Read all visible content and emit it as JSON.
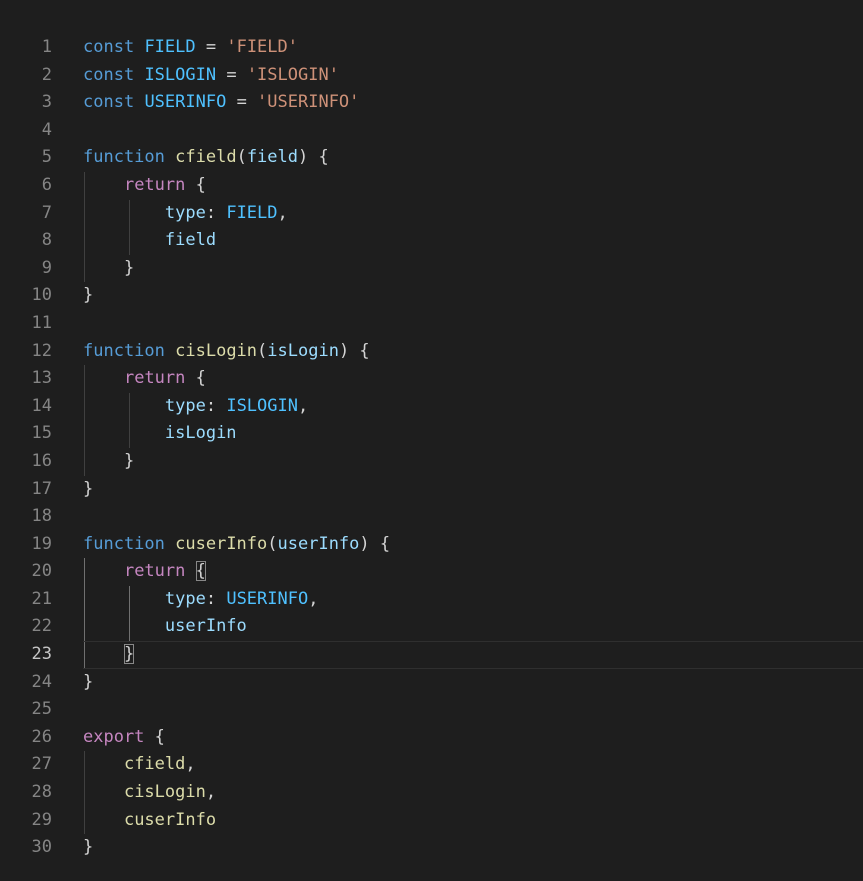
{
  "editor": {
    "active_line": 23,
    "lines": [
      {
        "n": "1",
        "tokens": [
          [
            "kw",
            "const"
          ],
          [
            "p",
            " "
          ],
          [
            "c",
            "FIELD"
          ],
          [
            "p",
            " = "
          ],
          [
            "s",
            "'FIELD'"
          ]
        ]
      },
      {
        "n": "2",
        "tokens": [
          [
            "kw",
            "const"
          ],
          [
            "p",
            " "
          ],
          [
            "c",
            "ISLOGIN"
          ],
          [
            "p",
            " = "
          ],
          [
            "s",
            "'ISLOGIN'"
          ]
        ]
      },
      {
        "n": "3",
        "tokens": [
          [
            "kw",
            "const"
          ],
          [
            "p",
            " "
          ],
          [
            "c",
            "USERINFO"
          ],
          [
            "p",
            " = "
          ],
          [
            "s",
            "'USERINFO'"
          ]
        ]
      },
      {
        "n": "4",
        "tokens": []
      },
      {
        "n": "5",
        "tokens": [
          [
            "kw",
            "function"
          ],
          [
            "p",
            " "
          ],
          [
            "f",
            "cfield"
          ],
          [
            "p",
            "("
          ],
          [
            "v",
            "field"
          ],
          [
            "p",
            ") {"
          ]
        ]
      },
      {
        "n": "6",
        "tokens": [
          [
            "p",
            "    "
          ],
          [
            "ctl",
            "return"
          ],
          [
            "p",
            " {"
          ]
        ]
      },
      {
        "n": "7",
        "tokens": [
          [
            "p",
            "        "
          ],
          [
            "v",
            "type"
          ],
          [
            "p",
            ": "
          ],
          [
            "c",
            "FIELD"
          ],
          [
            "p",
            ","
          ]
        ]
      },
      {
        "n": "8",
        "tokens": [
          [
            "p",
            "        "
          ],
          [
            "v",
            "field"
          ]
        ]
      },
      {
        "n": "9",
        "tokens": [
          [
            "p",
            "    }"
          ]
        ]
      },
      {
        "n": "10",
        "tokens": [
          [
            "p",
            "}"
          ]
        ]
      },
      {
        "n": "11",
        "tokens": []
      },
      {
        "n": "12",
        "tokens": [
          [
            "kw",
            "function"
          ],
          [
            "p",
            " "
          ],
          [
            "f",
            "cisLogin"
          ],
          [
            "p",
            "("
          ],
          [
            "v",
            "isLogin"
          ],
          [
            "p",
            ") {"
          ]
        ]
      },
      {
        "n": "13",
        "tokens": [
          [
            "p",
            "    "
          ],
          [
            "ctl",
            "return"
          ],
          [
            "p",
            " {"
          ]
        ]
      },
      {
        "n": "14",
        "tokens": [
          [
            "p",
            "        "
          ],
          [
            "v",
            "type"
          ],
          [
            "p",
            ": "
          ],
          [
            "c",
            "ISLOGIN"
          ],
          [
            "p",
            ","
          ]
        ]
      },
      {
        "n": "15",
        "tokens": [
          [
            "p",
            "        "
          ],
          [
            "v",
            "isLogin"
          ]
        ]
      },
      {
        "n": "16",
        "tokens": [
          [
            "p",
            "    }"
          ]
        ]
      },
      {
        "n": "17",
        "tokens": [
          [
            "p",
            "}"
          ]
        ]
      },
      {
        "n": "18",
        "tokens": []
      },
      {
        "n": "19",
        "tokens": [
          [
            "kw",
            "function"
          ],
          [
            "p",
            " "
          ],
          [
            "f",
            "cuserInfo"
          ],
          [
            "p",
            "("
          ],
          [
            "v",
            "userInfo"
          ],
          [
            "p",
            ") {"
          ]
        ]
      },
      {
        "n": "20",
        "tokens": [
          [
            "p",
            "    "
          ],
          [
            "ctl",
            "return"
          ],
          [
            "p",
            " "
          ],
          [
            "bm",
            "{"
          ]
        ]
      },
      {
        "n": "21",
        "tokens": [
          [
            "p",
            "        "
          ],
          [
            "v",
            "type"
          ],
          [
            "p",
            ": "
          ],
          [
            "c",
            "USERINFO"
          ],
          [
            "p",
            ","
          ]
        ]
      },
      {
        "n": "22",
        "tokens": [
          [
            "p",
            "        "
          ],
          [
            "v",
            "userInfo"
          ]
        ]
      },
      {
        "n": "23",
        "tokens": [
          [
            "p",
            "    "
          ],
          [
            "bm",
            "}"
          ]
        ]
      },
      {
        "n": "24",
        "tokens": [
          [
            "p",
            "}"
          ]
        ]
      },
      {
        "n": "25",
        "tokens": []
      },
      {
        "n": "26",
        "tokens": [
          [
            "ctl",
            "export"
          ],
          [
            "p",
            " {"
          ]
        ]
      },
      {
        "n": "27",
        "tokens": [
          [
            "p",
            "    "
          ],
          [
            "f",
            "cfield"
          ],
          [
            "p",
            ","
          ]
        ]
      },
      {
        "n": "28",
        "tokens": [
          [
            "p",
            "    "
          ],
          [
            "f",
            "cisLogin"
          ],
          [
            "p",
            ","
          ]
        ]
      },
      {
        "n": "29",
        "tokens": [
          [
            "p",
            "    "
          ],
          [
            "f",
            "cuserInfo"
          ]
        ]
      },
      {
        "n": "30",
        "tokens": [
          [
            "p",
            "}"
          ]
        ]
      }
    ]
  },
  "theme": {
    "background": "#1e1e1e",
    "keyword": "#569cd6",
    "constant": "#4fc1ff",
    "string": "#ce9178",
    "function": "#dcdcaa",
    "variable": "#9cdcfe",
    "control": "#c586c0",
    "line_number": "#858585"
  }
}
